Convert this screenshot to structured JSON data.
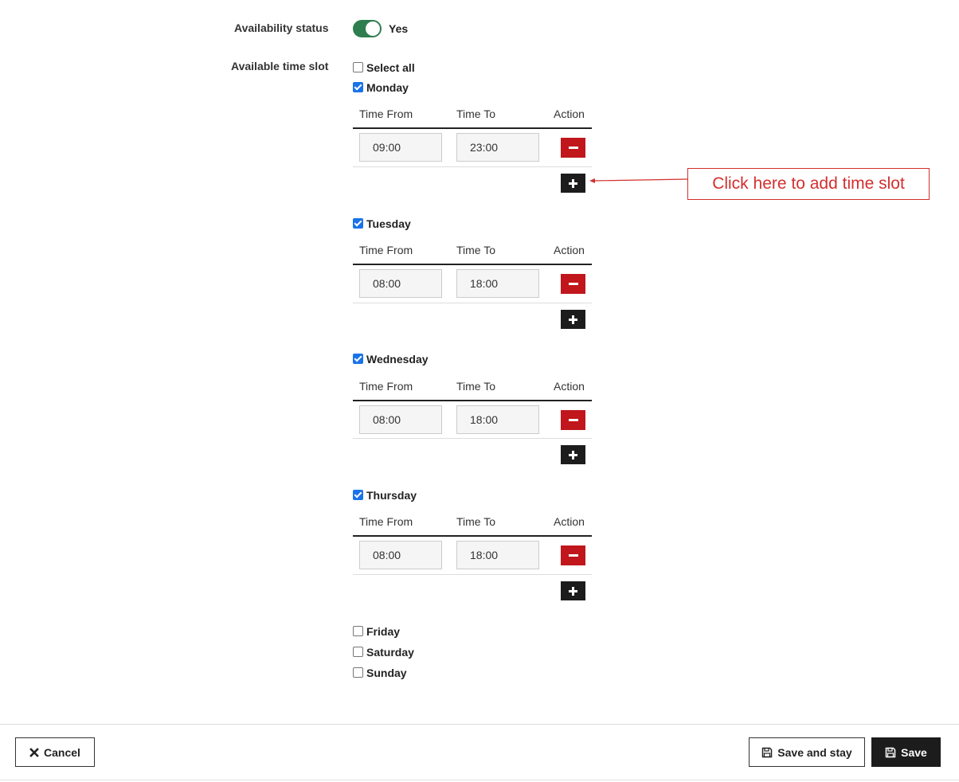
{
  "availability": {
    "label": "Availability status",
    "toggle_value": "Yes",
    "enabled": true
  },
  "time_slot": {
    "label": "Available time slot",
    "select_all": "Select all",
    "columns": {
      "from": "Time From",
      "to": "Time To",
      "action": "Action"
    },
    "days": [
      {
        "name": "Monday",
        "checked": true,
        "from": "09:00",
        "to": "23:00"
      },
      {
        "name": "Tuesday",
        "checked": true,
        "from": "08:00",
        "to": "18:00"
      },
      {
        "name": "Wednesday",
        "checked": true,
        "from": "08:00",
        "to": "18:00"
      },
      {
        "name": "Thursday",
        "checked": true,
        "from": "08:00",
        "to": "18:00"
      },
      {
        "name": "Friday",
        "checked": false
      },
      {
        "name": "Saturday",
        "checked": false
      },
      {
        "name": "Sunday",
        "checked": false
      }
    ]
  },
  "annotation": {
    "text": "Click here to add time slot",
    "color": "#d32f2f"
  },
  "footer": {
    "cancel": "Cancel",
    "save_and_stay": "Save and stay",
    "save": "Save"
  },
  "colors": {
    "toggle_on": "#2e7d4f",
    "remove": "#c0161c",
    "add": "#1c1c1c",
    "checkbox": "#1a73e8"
  },
  "icons": {
    "remove": "minus-icon",
    "add": "plus-icon",
    "cancel": "x-icon",
    "save": "floppy-disk-icon"
  }
}
